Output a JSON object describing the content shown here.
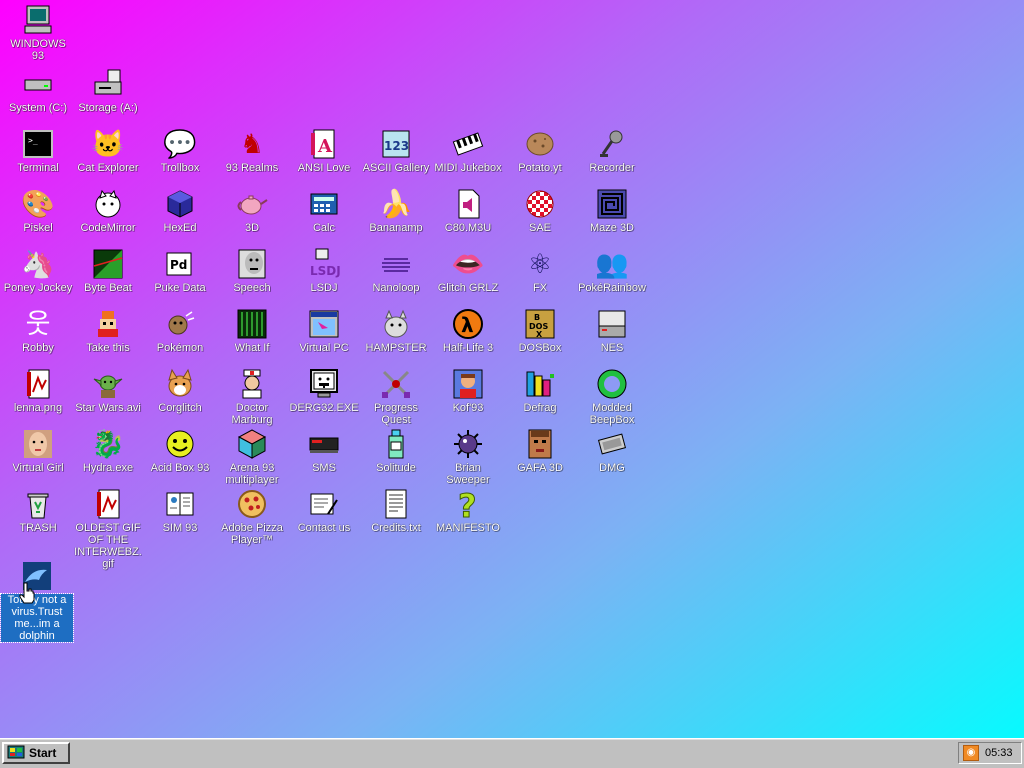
{
  "colors": {
    "bg_start": "#ff00ff",
    "bg_end": "#00ffff",
    "taskbar": "#c0c0c0",
    "selection": "#1e6ec2"
  },
  "desktop": {
    "icons": [
      {
        "label": "WINDOWS 93",
        "icon": "computer-icon",
        "glyph": "🖥"
      },
      {
        "label": "System (C:)",
        "icon": "hard-drive-icon",
        "glyph": "▭"
      },
      {
        "label": "Storage (A:)",
        "icon": "floppy-drive-icon",
        "glyph": "💾"
      },
      {
        "label": "Terminal",
        "icon": "terminal-icon",
        "glyph": "▣"
      },
      {
        "label": "Cat Explorer",
        "icon": "cat-globe-icon",
        "glyph": "🐱"
      },
      {
        "label": "Trollbox",
        "icon": "chat-icon",
        "glyph": "💬"
      },
      {
        "label": "93 Realms",
        "icon": "knight-icon",
        "glyph": "♞"
      },
      {
        "label": "ANSI Love",
        "icon": "letter-a-icon",
        "glyph": "A"
      },
      {
        "label": "ASCII Gallery",
        "icon": "numbers-icon",
        "glyph": "123"
      },
      {
        "label": "MIDI Jukebox",
        "icon": "piano-icon",
        "glyph": "🎹"
      },
      {
        "label": "Potato.yt",
        "icon": "potato-icon",
        "glyph": "🥔"
      },
      {
        "label": "Recorder",
        "icon": "microphone-icon",
        "glyph": "🎤"
      },
      {
        "label": "Piskel",
        "icon": "palette-icon",
        "glyph": "🎨"
      },
      {
        "label": "CodeMirror",
        "icon": "white-cat-icon",
        "glyph": "🐈"
      },
      {
        "label": "HexEd",
        "icon": "cube-icon",
        "glyph": "⬢"
      },
      {
        "label": "3D",
        "icon": "teapot-icon",
        "glyph": "🫖"
      },
      {
        "label": "Calc",
        "icon": "calculator-icon",
        "glyph": "🖩"
      },
      {
        "label": "Bananamp",
        "icon": "banana-icon",
        "glyph": "🍌"
      },
      {
        "label": "C80.M3U",
        "icon": "audio-file-icon",
        "glyph": "🔈"
      },
      {
        "label": "SAE",
        "icon": "checkered-ball-icon",
        "glyph": "⚽"
      },
      {
        "label": "Maze 3D",
        "icon": "maze-icon",
        "glyph": "▦"
      },
      {
        "label": "Poney Jockey",
        "icon": "pony-icon",
        "glyph": "🦄"
      },
      {
        "label": "Byte Beat",
        "icon": "waveform-icon",
        "glyph": "◢"
      },
      {
        "label": "Puke Data",
        "icon": "pd-icon",
        "glyph": "Pd"
      },
      {
        "label": "Speech",
        "icon": "face-icon",
        "glyph": "🗣"
      },
      {
        "label": "LSDJ",
        "icon": "gameboy-icon",
        "glyph": "🎮"
      },
      {
        "label": "Nanoloop",
        "icon": "lines-icon",
        "glyph": "≋"
      },
      {
        "label": "Glitch GRLZ",
        "icon": "lips-icon",
        "glyph": "👄"
      },
      {
        "label": "FX",
        "icon": "atom-icon",
        "glyph": "⚛"
      },
      {
        "label": "PokéRainbow",
        "icon": "trainers-icon",
        "glyph": "👥"
      },
      {
        "label": "Robby",
        "icon": "stick-figure-icon",
        "glyph": "웃"
      },
      {
        "label": "Take this",
        "icon": "pixel-character-icon",
        "glyph": "👾"
      },
      {
        "label": "Pokémon",
        "icon": "pokemon-icon",
        "glyph": "🐾"
      },
      {
        "label": "What If",
        "icon": "matrix-icon",
        "glyph": "▥"
      },
      {
        "label": "Virtual PC",
        "icon": "window-icon",
        "glyph": "🗔"
      },
      {
        "label": "HAMPSTER",
        "icon": "hamster-icon",
        "glyph": "🐹"
      },
      {
        "label": "Half-Life 3",
        "icon": "lambda-icon",
        "glyph": "λ"
      },
      {
        "label": "DOSBox",
        "icon": "dosbox-icon",
        "glyph": "▩"
      },
      {
        "label": "NES",
        "icon": "nes-console-icon",
        "glyph": "▤"
      },
      {
        "label": "lenna.png",
        "icon": "image-file-icon",
        "glyph": "🖻"
      },
      {
        "label": "Star Wars.avi",
        "icon": "yoda-icon",
        "glyph": "👽"
      },
      {
        "label": "Corglitch",
        "icon": "corgi-icon",
        "glyph": "🐕"
      },
      {
        "label": "Doctor Marburg",
        "icon": "doctor-icon",
        "glyph": "🩺"
      },
      {
        "label": "DERG32.EXE",
        "icon": "monitor-face-icon",
        "glyph": "😛"
      },
      {
        "label": "Progress Quest",
        "icon": "crossed-swords-icon",
        "glyph": "⚔"
      },
      {
        "label": "Kof'93",
        "icon": "fighter-icon",
        "glyph": "🥊"
      },
      {
        "label": "Defrag",
        "icon": "defrag-icon",
        "glyph": "▧"
      },
      {
        "label": "Modded BeepBox",
        "icon": "green-ring-icon",
        "glyph": "◯"
      },
      {
        "label": "Virtual Girl",
        "icon": "girl-face-icon",
        "glyph": "👩"
      },
      {
        "label": "Hydra.exe",
        "icon": "dragon-icon",
        "glyph": "🐉"
      },
      {
        "label": "Acid Box 93",
        "icon": "smiley-icon",
        "glyph": "☺"
      },
      {
        "label": "Arena 93 multiplayer",
        "icon": "cube-3d-icon",
        "glyph": "◈"
      },
      {
        "label": "SMS",
        "icon": "sega-console-icon",
        "glyph": "▬"
      },
      {
        "label": "Solitude",
        "icon": "bottle-icon",
        "glyph": "🧴"
      },
      {
        "label": "Brian Sweeper",
        "icon": "mine-icon",
        "glyph": "✹"
      },
      {
        "label": "GAFA 3D",
        "icon": "doom-face-icon",
        "glyph": "😠"
      },
      {
        "label": "DMG",
        "icon": "cartridge-icon",
        "glyph": "▰"
      },
      {
        "label": "TRASH",
        "icon": "trash-icon",
        "glyph": "🗑"
      },
      {
        "label": "OLDEST GIF OF THE INTERWEBZ.gif",
        "icon": "gif-file-icon",
        "glyph": "🖼"
      },
      {
        "label": "SIM 93",
        "icon": "book-icon",
        "glyph": "📖"
      },
      {
        "label": "Adobe Pizza Player™",
        "icon": "pizza-icon",
        "glyph": "🍕"
      },
      {
        "label": "Contact us",
        "icon": "mail-icon",
        "glyph": "✉"
      },
      {
        "label": "Credits.txt",
        "icon": "text-file-icon",
        "glyph": "📄"
      },
      {
        "label": "MANIFESTO",
        "icon": "question-mark-icon",
        "glyph": "?"
      },
      {
        "label": "Totally not a virus.Trust me...im a dolphin",
        "icon": "dolphin-icon",
        "glyph": "🐬"
      }
    ]
  },
  "taskbar": {
    "start_label": "Start",
    "tray_icon": "rss-icon",
    "clock": "05:33"
  }
}
